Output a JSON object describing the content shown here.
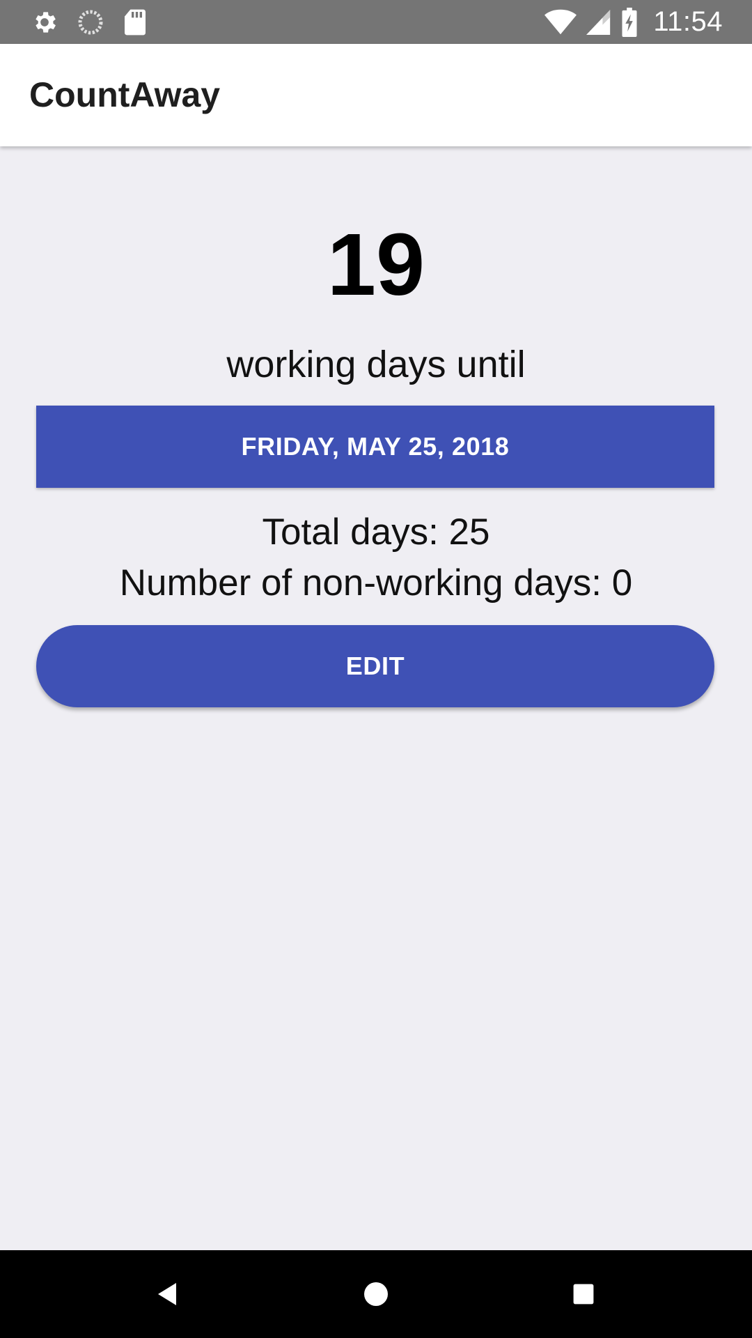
{
  "status_bar": {
    "time": "11:54",
    "left_icons": [
      "settings-icon",
      "sync-icon",
      "sd-card-icon"
    ],
    "right_icons": [
      "wifi-icon",
      "cell-signal-icon",
      "battery-charging-icon"
    ]
  },
  "app_bar": {
    "title": "CountAway"
  },
  "countdown": {
    "count": "19",
    "label": "working days until",
    "date_button": "FRIDAY, MAY 25, 2018",
    "total_days": "Total days: 25",
    "non_working_days": "Number of non-working days: 0",
    "edit_button": "EDIT"
  },
  "nav_bar": {
    "icons": [
      "back-icon",
      "home-icon",
      "recents-icon"
    ]
  },
  "colors": {
    "accent": "#3f51b5",
    "background": "#efeef3",
    "status_bar": "#757575"
  }
}
